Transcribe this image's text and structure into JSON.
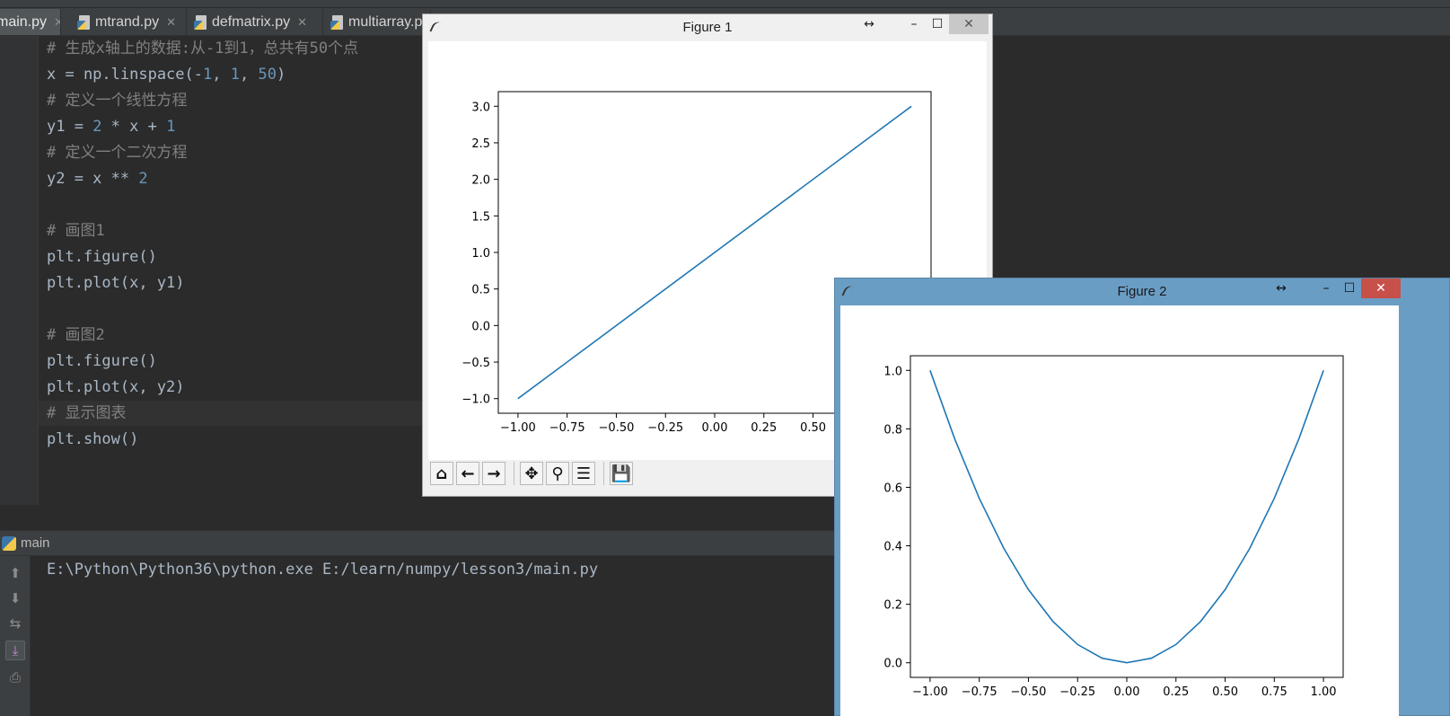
{
  "ide": {
    "tabs": [
      {
        "label": "main.py",
        "active": true
      },
      {
        "label": "mtrand.py"
      },
      {
        "label": "defmatrix.py"
      },
      {
        "label": "multiarray.py"
      }
    ],
    "code_lines": [
      {
        "text": "# 生成x轴上的数据:从-1到1，总共有50个点",
        "kind": "comment"
      },
      {
        "text": "x = np.linspace(-1, 1, 50)",
        "kind": "code"
      },
      {
        "text": "# 定义一个线性方程",
        "kind": "comment"
      },
      {
        "text": "y1 = 2 * x + 1",
        "kind": "code"
      },
      {
        "text": "# 定义一个二次方程",
        "kind": "comment"
      },
      {
        "text": "y2 = x ** 2",
        "kind": "code"
      },
      {
        "text": "",
        "kind": "code"
      },
      {
        "text": "# 画图1",
        "kind": "comment"
      },
      {
        "text": "plt.figure()",
        "kind": "code"
      },
      {
        "text": "plt.plot(x, y1)",
        "kind": "code"
      },
      {
        "text": "",
        "kind": "code"
      },
      {
        "text": "# 画图2",
        "kind": "comment"
      },
      {
        "text": "plt.figure()",
        "kind": "code"
      },
      {
        "text": "plt.plot(x, y2)",
        "kind": "code"
      },
      {
        "text": "# 显示图表",
        "kind": "comment"
      },
      {
        "text": "plt.show()",
        "kind": "code"
      }
    ],
    "run": {
      "name": "main",
      "output": "E:\\Python\\Python36\\python.exe E:/learn/numpy/lesson3/main.py"
    },
    "colors": {
      "background": "#2b2b2b",
      "comment": "#808080",
      "number": "#6897bb",
      "text": "#a9b7c6"
    }
  },
  "figure1": {
    "title": "Figure 1",
    "buttons": {
      "restore": "↔",
      "minimize": "–",
      "maximize": "☐",
      "close": "✕"
    },
    "toolbar": [
      {
        "name": "home-icon",
        "glyph": "⌂"
      },
      {
        "name": "back-icon",
        "glyph": "←"
      },
      {
        "name": "forward-icon",
        "glyph": "→"
      },
      {
        "name": "pan-icon",
        "glyph": "✥"
      },
      {
        "name": "zoom-icon",
        "glyph": "⚲"
      },
      {
        "name": "configure-icon",
        "glyph": "☰"
      },
      {
        "name": "save-icon",
        "glyph": "💾"
      }
    ]
  },
  "figure2": {
    "title": "Figure 2",
    "buttons": {
      "restore": "↔",
      "minimize": "–",
      "maximize": "☐",
      "close": "✕"
    }
  },
  "chart_data": [
    {
      "type": "line",
      "title": "",
      "xlabel": "",
      "ylabel": "",
      "xlim": [
        -1.1,
        1.1
      ],
      "ylim": [
        -1.2,
        3.2
      ],
      "xticks": [
        -1.0,
        -0.75,
        -0.5,
        -0.25,
        0.0,
        0.25,
        0.5
      ],
      "xtick_labels": [
        "−1.00",
        "−0.75",
        "−0.50",
        "−0.25",
        "0.00",
        "0.25",
        "0.50"
      ],
      "yticks": [
        -1.0,
        -0.5,
        0.0,
        0.5,
        1.0,
        1.5,
        2.0,
        2.5,
        3.0
      ],
      "ytick_labels": [
        "−1.0",
        "−0.5",
        "0.0",
        "0.5",
        "1.0",
        "1.5",
        "2.0",
        "2.5",
        "3.0"
      ],
      "series": [
        {
          "x": [
            -1,
            1
          ],
          "y": [
            -1,
            3
          ],
          "color": "#1f77b4"
        }
      ]
    },
    {
      "type": "line",
      "title": "",
      "xlabel": "",
      "ylabel": "",
      "xlim": [
        -1.1,
        1.1
      ],
      "ylim": [
        -0.05,
        1.05
      ],
      "xticks": [
        -1.0,
        -0.75,
        -0.5,
        -0.25,
        0.0,
        0.25,
        0.5,
        0.75,
        1.0
      ],
      "xtick_labels": [
        "−1.00",
        "−0.75",
        "−0.50",
        "−0.25",
        "0.00",
        "0.25",
        "0.50",
        "0.75",
        "1.00"
      ],
      "yticks": [
        0.0,
        0.2,
        0.4,
        0.6,
        0.8,
        1.0
      ],
      "ytick_labels": [
        "0.0",
        "0.2",
        "0.4",
        "0.6",
        "0.8",
        "1.0"
      ],
      "series": [
        {
          "x": [
            -1.0,
            -0.875,
            -0.75,
            -0.625,
            -0.5,
            -0.375,
            -0.25,
            -0.125,
            0.0,
            0.125,
            0.25,
            0.375,
            0.5,
            0.625,
            0.75,
            0.875,
            1.0
          ],
          "y": [
            1.0,
            0.766,
            0.5625,
            0.391,
            0.25,
            0.141,
            0.0625,
            0.0156,
            0.0,
            0.0156,
            0.0625,
            0.141,
            0.25,
            0.391,
            0.5625,
            0.766,
            1.0
          ],
          "color": "#1f77b4"
        }
      ]
    }
  ]
}
